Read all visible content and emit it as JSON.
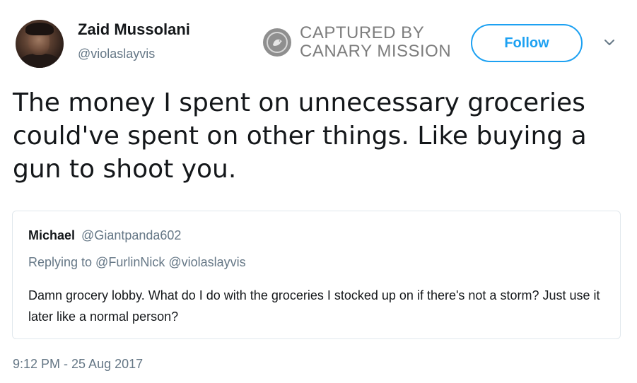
{
  "tweet": {
    "author": {
      "display_name": "Zaid Mussolani",
      "handle": "@violaslayvis"
    },
    "follow_label": "Follow",
    "text": "The money I spent on unnecessary groceries could've spent on other things. Like buying a gun to shoot you.",
    "timestamp": "9:12 PM - 25 Aug 2017"
  },
  "watermark": {
    "line1": "CAPTURED BY",
    "line2": "CANARY MISSION"
  },
  "quoted_tweet": {
    "display_name": "Michael",
    "handle": "@Giantpanda602",
    "replying_to": "Replying to @FurlinNick @violaslayvis",
    "text": "Damn grocery lobby. What do I do with the groceries I stocked up on if there's not a storm? Just use it later like a normal person?"
  },
  "icons": {
    "caret": "chevron-down-icon",
    "watermark_seal": "bird-seal-icon"
  },
  "colors": {
    "accent": "#1da1f2",
    "secondary_text": "#657786",
    "primary_text": "#14171a",
    "border": "#e1e8ed",
    "watermark": "#7d7d7d"
  }
}
